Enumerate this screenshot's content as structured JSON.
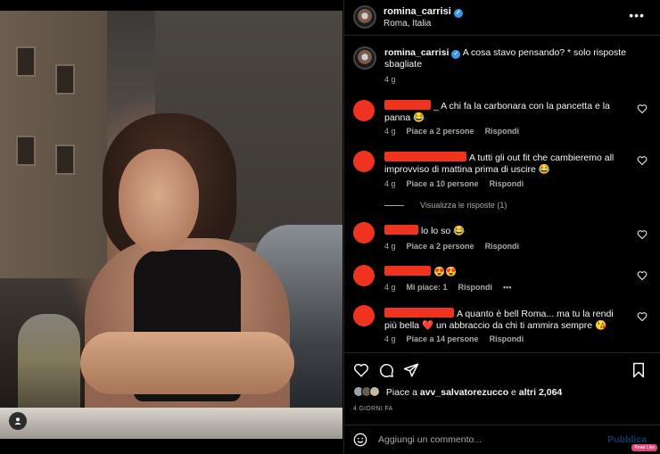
{
  "post": {
    "username": "romina_carrisi",
    "location": "Roma, Italia",
    "caption": "A cosa stavo pensando? * solo risposte sbagliate",
    "caption_time": "4 g",
    "icons": {
      "more": "more-dots-icon",
      "verified": "verified-badge-icon",
      "user_tag": "user-tag-icon"
    }
  },
  "comments": [
    {
      "text": "_ A chi fa la carbonara con la pancetta e la panna 😂",
      "time": "4 g",
      "likes": "Piace a 2 persone",
      "reply": "Rispondi"
    },
    {
      "text": "A tutti gli out fit che cambieremo all improvviso di mattina prima di uscire 😂",
      "time": "4 g",
      "likes": "Piace a 10 persone",
      "reply": "Rispondi",
      "view_replies": "Visualizza le risposte (1)"
    },
    {
      "text": "lo lo so 😂",
      "time": "4 g",
      "likes": "Piace a 2 persone",
      "reply": "Rispondi"
    },
    {
      "text": "😍😍",
      "time": "4 g",
      "likes": "Mi piace: 1",
      "reply": "Rispondi",
      "more": "•••"
    },
    {
      "text": "A quanto è bell Roma... ma tu la rendi più bella ❤️ un abbraccio da chi ti ammira sempre 😘",
      "time": "4 g",
      "likes": "Piace a 14 persone",
      "reply": "Rispondi"
    }
  ],
  "actions": {
    "icons": [
      "heart-icon",
      "comment-icon",
      "share-icon",
      "bookmark-icon"
    ]
  },
  "likes_summary": {
    "prefix": "Piace a",
    "user": "avv_salvatorezucco",
    "middle": "e",
    "others": "altri 2,064"
  },
  "post_date": "4 GIORNI FA",
  "comment_box": {
    "placeholder": "Aggiungi un commento...",
    "publish": "Pubblica"
  },
  "watermark": "Read Like",
  "colors": {
    "redaction": "#f0331f",
    "accent": "#3897f0",
    "muted": "#a8a8a8"
  }
}
